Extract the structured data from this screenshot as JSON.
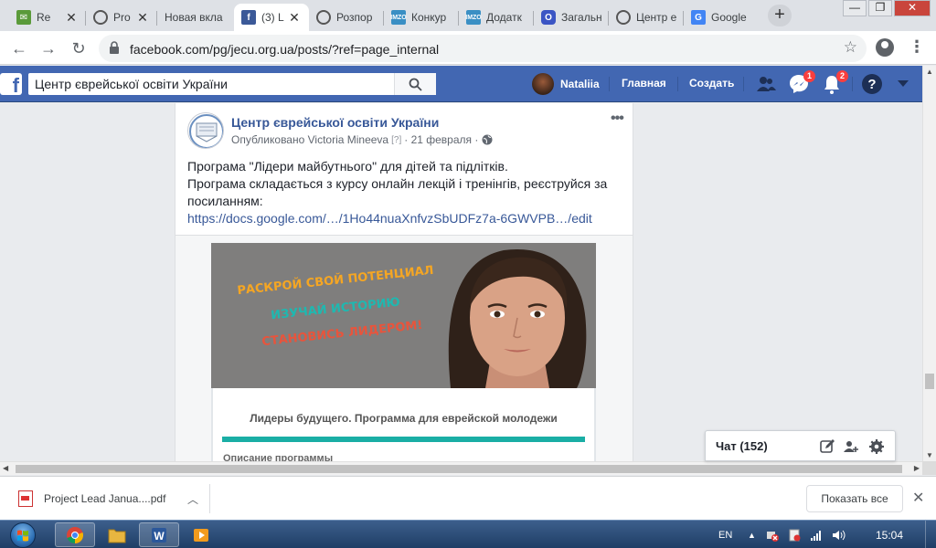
{
  "browser": {
    "tabs": [
      {
        "title": "Re",
        "favicon": "green-mail-icon",
        "active": false
      },
      {
        "title": "Pro",
        "favicon": "globe-icon",
        "active": false
      },
      {
        "title": "Новая вкла",
        "favicon": "none",
        "active": false
      },
      {
        "title": "(3) L",
        "favicon": "facebook-icon",
        "active": true
      },
      {
        "title": "Розпор",
        "favicon": "globe-icon",
        "active": false
      },
      {
        "title": "Конкур",
        "favicon": "imzo-icon",
        "active": false
      },
      {
        "title": "Додатк",
        "favicon": "imzo-icon",
        "active": false
      },
      {
        "title": "Загальн",
        "favicon": "blue-o-icon",
        "active": false
      },
      {
        "title": "Центр е",
        "favicon": "globe-icon",
        "active": false
      },
      {
        "title": "Google",
        "favicon": "google-translate-icon",
        "active": false
      }
    ],
    "new_tab": "+",
    "url": "facebook.com/pg/jecu.org.ua/posts/?ref=page_internal"
  },
  "facebook": {
    "search_value": "Центр єврейської освіти України",
    "user_name": "Nataliia",
    "home_label": "Главная",
    "create_label": "Создать",
    "messenger_badge": "1",
    "notifications_badge": "2"
  },
  "post": {
    "author": "Центр єврейської освіти України",
    "published_by": "Опубликовано Victoria Mineeva",
    "help": "[?]",
    "date": "· 21 февраля ·",
    "line1": "Програма \"Лідери майбутнього\" для дітей та підлітків.",
    "line2": "Програма складається з курсу онлайн лекцій і тренінгів, реєструйся за посиланням:",
    "link": "https://docs.google.com/…/1Ho44nuaXnfvzSbUDFz7a-6GWVPB…/edit",
    "more": "•••",
    "image": {
      "slogan1": "РАСКРОЙ СВОЙ ПОТЕНЦИАЛ",
      "slogan2": "ИЗУЧАЙ ИСТОРИЮ",
      "slogan3": "СТАНОВИСЬ ЛИДЕРОМ!",
      "subtitle": "Лидеры будущего. Программа для еврейской молодежи",
      "desc": "Описание программы"
    }
  },
  "chat": {
    "label": "Чат (152)"
  },
  "downloads": {
    "file_name": "Project Lead Janua....pdf",
    "show_all": "Показать все"
  },
  "taskbar": {
    "lang": "EN",
    "time": "15:04"
  },
  "colors": {
    "facebook_blue": "#4267b2",
    "link": "#385898",
    "teal": "#1aaea5",
    "badge": "#fa3e3e"
  }
}
